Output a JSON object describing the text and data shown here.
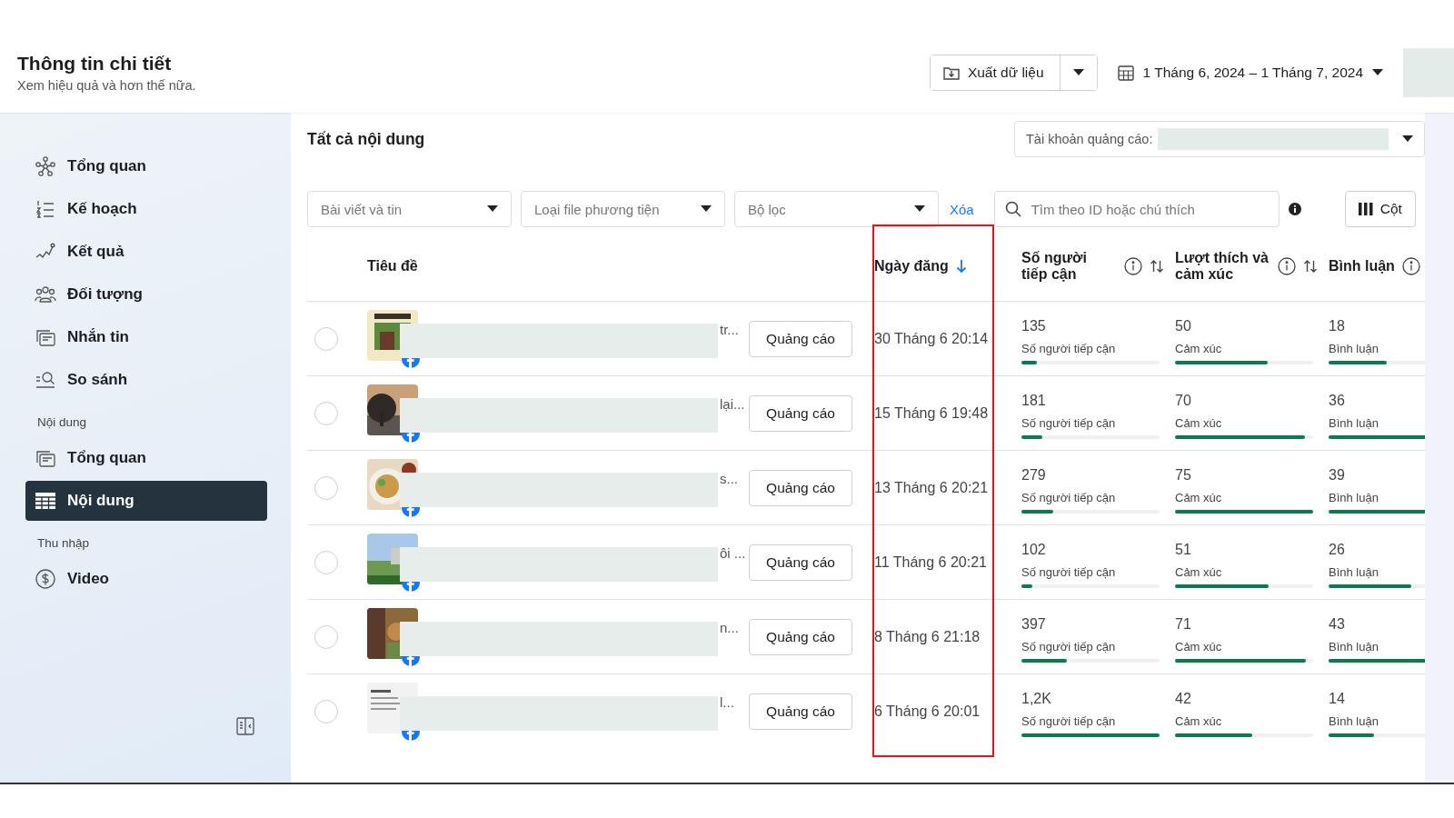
{
  "header": {
    "title": "Thông tin chi tiết",
    "subtitle": "Xem hiệu quả và hơn thế nữa.",
    "export_button": "Xuất dữ liệu",
    "date_range": "1 Tháng 6, 2024 – 1 Tháng 7, 2024"
  },
  "sidebar": {
    "groups": [
      {
        "items": [
          {
            "label": "Tổng quan",
            "kind": "network",
            "selected": false
          },
          {
            "label": "Kế hoạch",
            "kind": "list",
            "selected": false
          },
          {
            "label": "Kết quả",
            "kind": "trend",
            "selected": false
          },
          {
            "label": "Đối tượng",
            "kind": "people",
            "selected": false
          },
          {
            "label": "Nhắn tin",
            "kind": "cards",
            "selected": false
          },
          {
            "label": "So sánh",
            "kind": "compare",
            "selected": false
          }
        ]
      },
      {
        "heading": "Nội dung",
        "items": [
          {
            "label": "Tổng quan",
            "kind": "cards",
            "selected": false
          },
          {
            "label": "Nội dung",
            "kind": "table",
            "selected": true
          }
        ]
      },
      {
        "heading": "Thu nhập",
        "items": [
          {
            "label": "Video",
            "kind": "dollar",
            "selected": false
          }
        ]
      }
    ]
  },
  "content": {
    "title": "Tất cả nội dung",
    "ad_account_label": "Tài khoản quảng cáo:",
    "filters": [
      {
        "label": "Bài viết và tin"
      },
      {
        "label": "Loại file phương tiện"
      },
      {
        "label": "Bộ lọc"
      }
    ],
    "clear_link": "Xóa",
    "search": {
      "placeholder": "Tìm theo ID hoặc chú thích"
    },
    "columns_button": "Cột"
  },
  "table": {
    "columns": [
      {
        "label": "Tiêu đề",
        "sorted": false,
        "sortable": false,
        "info": false,
        "highlighted": false
      },
      {
        "label": "Ngày đăng",
        "sorted": true,
        "sortable": false,
        "info": false,
        "highlighted": true
      },
      {
        "label": "Số người tiếp cận",
        "sorted": false,
        "sortable": true,
        "info": true,
        "highlighted": false
      },
      {
        "label": "Lượt thích và cảm xúc",
        "sorted": false,
        "sortable": true,
        "info": true,
        "highlighted": false
      },
      {
        "label": "Bình luận",
        "sorted": false,
        "sortable": false,
        "info": true,
        "highlighted": false
      }
    ],
    "rows": [
      {
        "selected": false,
        "title_tail": "tr...",
        "button": "Quảng cáo",
        "date": "30 Tháng 6 20:14",
        "metrics": [
          {
            "value": "135",
            "label": "Số người tiếp cận",
            "level": 0.11
          },
          {
            "value": "50",
            "label": "Cảm xúc",
            "level": 0.67
          },
          {
            "value": "18",
            "label": "Bình luận",
            "level": 0.42
          }
        ]
      },
      {
        "selected": false,
        "title_tail": "lại...",
        "button": "Quảng cáo",
        "date": "15 Tháng 6 19:48",
        "metrics": [
          {
            "value": "181",
            "label": "Số người tiếp cận",
            "level": 0.15
          },
          {
            "value": "70",
            "label": "Cảm xúc",
            "level": 0.94
          },
          {
            "value": "36",
            "label": "Bình luận",
            "level": 0.84
          }
        ]
      },
      {
        "selected": false,
        "title_tail": "s...",
        "button": "Quảng cáo",
        "date": "13 Tháng 6 20:21",
        "metrics": [
          {
            "value": "279",
            "label": "Số người tiếp cận",
            "level": 0.23
          },
          {
            "value": "75",
            "label": "Cảm xúc",
            "level": 1
          },
          {
            "value": "39",
            "label": "Bình luận",
            "level": 0.91
          }
        ]
      },
      {
        "selected": false,
        "title_tail": "ôi ...",
        "button": "Quảng cáo",
        "date": "11 Tháng 6 20:21",
        "metrics": [
          {
            "value": "102",
            "label": "Số người tiếp cận",
            "level": 0.08
          },
          {
            "value": "51",
            "label": "Cảm xúc",
            "level": 0.68
          },
          {
            "value": "26",
            "label": "Bình luận",
            "level": 0.6
          }
        ]
      },
      {
        "selected": false,
        "title_tail": "n...",
        "button": "Quảng cáo",
        "date": "8 Tháng 6 21:18",
        "metrics": [
          {
            "value": "397",
            "label": "Số người tiếp cận",
            "level": 0.33
          },
          {
            "value": "71",
            "label": "Cảm xúc",
            "level": 0.95
          },
          {
            "value": "43",
            "label": "Bình luận",
            "level": 1
          }
        ]
      },
      {
        "selected": false,
        "title_tail": "l...",
        "button": "Quảng cáo",
        "date": "6 Tháng 6 20:01",
        "metrics": [
          {
            "value": "1,2K",
            "label": "Số người tiếp cận",
            "level": 1
          },
          {
            "value": "42",
            "label": "Cảm xúc",
            "level": 0.56
          },
          {
            "value": "14",
            "label": "Bình luận",
            "level": 0.33
          }
        ]
      }
    ]
  }
}
